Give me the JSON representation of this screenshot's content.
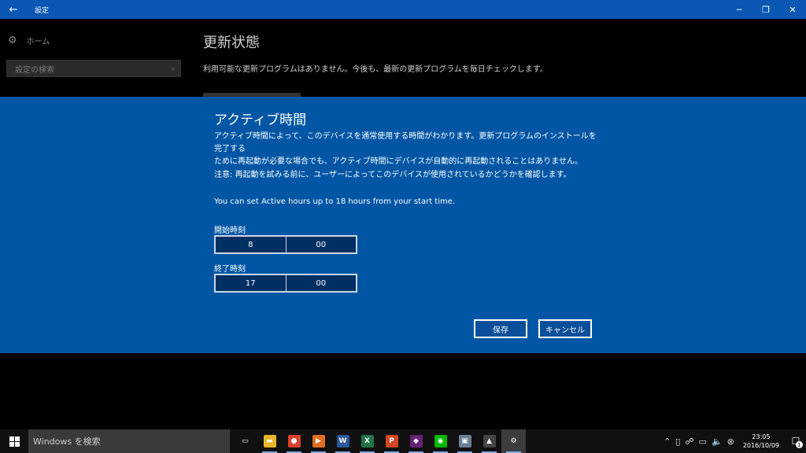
{
  "titlebar": {
    "back_icon": "←",
    "title": "設定",
    "minimize_icon": "─",
    "restore_icon": "❐",
    "close_icon": "✕"
  },
  "sidebar": {
    "home_label": "ホーム",
    "search_placeholder": "設定の検索"
  },
  "main": {
    "title": "更新状態",
    "description": "利用可能な更新プログラムはありません。今後も、最新の更新プログラムを毎日チェックします。"
  },
  "dialog": {
    "title": "アクティブ時間",
    "paragraph1_line1": "アクティブ時間によって、このデバイスを通常使用する時間がわかります。更新プログラムのインストールを完了する",
    "paragraph1_line2": "ために再起動が必要な場合でも、アクティブ時間にデバイスが自動的に再起動されることはありません。",
    "paragraph2": "注意: 再起動を試みる前に、ユーザーによってこのデバイスが使用されているかどうかを確認します。",
    "paragraph3": "You can set Active hours up to 18 hours from your start time.",
    "start_label": "開始時刻",
    "start_hour": "8",
    "start_minute": "00",
    "end_label": "終了時刻",
    "end_hour": "17",
    "end_minute": "00",
    "save_label": "保存",
    "cancel_label": "キャンセル"
  },
  "taskbar": {
    "search_placeholder": "Windows を検索",
    "apps": [
      {
        "name": "task-view",
        "glyph": "▭",
        "color": "#101010"
      },
      {
        "name": "file-explorer",
        "glyph": "▬",
        "color": "#e8b62a"
      },
      {
        "name": "chrome",
        "glyph": "●",
        "color": "#d8432f"
      },
      {
        "name": "media-player",
        "glyph": "▶",
        "color": "#e06e1e"
      },
      {
        "name": "word",
        "glyph": "W",
        "color": "#2b579a"
      },
      {
        "name": "excel",
        "glyph": "X",
        "color": "#217346"
      },
      {
        "name": "powerpoint",
        "glyph": "P",
        "color": "#d24726"
      },
      {
        "name": "visual-studio",
        "glyph": "◆",
        "color": "#68217a"
      },
      {
        "name": "line",
        "glyph": "◉",
        "color": "#00b900"
      },
      {
        "name": "network-app",
        "glyph": "▣",
        "color": "#6a7f93"
      },
      {
        "name": "photos",
        "glyph": "▲",
        "color": "#444444"
      },
      {
        "name": "settings",
        "glyph": "⚙",
        "color": "#3c3c3c"
      }
    ],
    "clock_time": "23:05",
    "clock_date": "2016/10/09",
    "notification_count": "1"
  }
}
